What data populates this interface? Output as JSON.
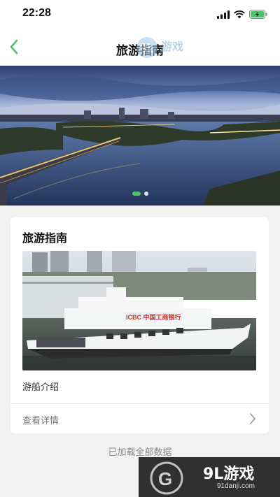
{
  "status_bar": {
    "time": "22:28"
  },
  "nav": {
    "title": "旅游指南",
    "back_icon": "chevron-left-icon"
  },
  "banner": {
    "slide_count": 2,
    "active_slide": 1
  },
  "card": {
    "title": "旅游指南",
    "subtitle": "游船介绍",
    "link_label": "查看详情",
    "ship_signage": "ICBC 中国工商银行"
  },
  "footer": {
    "text": "已加载全部数据"
  },
  "watermark": {
    "brand": "9L游戏",
    "url": "91danji.com",
    "top_brand": "9L游戏"
  },
  "colors": {
    "accent": "#4cc36a",
    "background": "#f2f2f2"
  }
}
